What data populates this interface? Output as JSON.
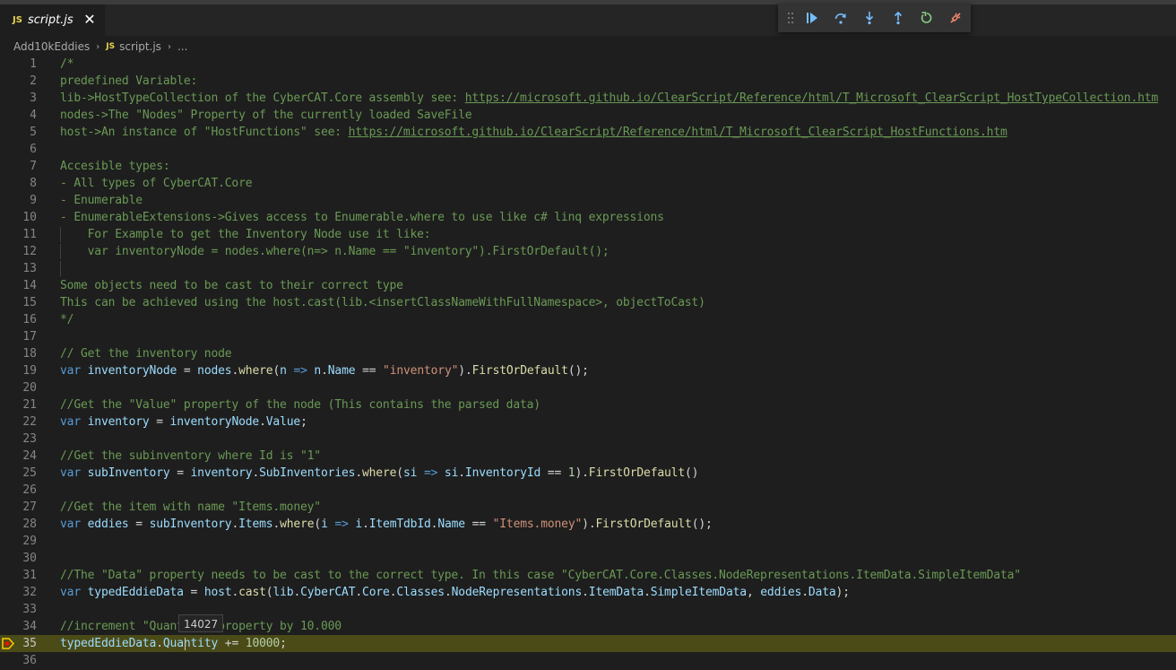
{
  "tab": {
    "badge": "JS",
    "label": "script.js",
    "close": "✕"
  },
  "breadcrumb": {
    "folder": "Add10kEddies",
    "badge": "JS",
    "file": "script.js",
    "more": "..."
  },
  "hover": {
    "value": "14027"
  },
  "lines": [
    {
      "n": "1",
      "t": [
        [
          "c",
          "/*"
        ]
      ]
    },
    {
      "n": "2",
      "t": [
        [
          "c",
          "predefined Variable:"
        ]
      ]
    },
    {
      "n": "3",
      "t": [
        [
          "c",
          "lib->HostTypeCollection of the CyberCAT.Core assembly see: "
        ],
        [
          "lnk",
          "https://microsoft.github.io/ClearScript/Reference/html/T_Microsoft_ClearScript_HostTypeCollection.htm"
        ]
      ]
    },
    {
      "n": "4",
      "t": [
        [
          "c",
          "nodes->The \"Nodes\" Property of the currently loaded SaveFile"
        ]
      ]
    },
    {
      "n": "5",
      "t": [
        [
          "c",
          "host->An instance of \"HostFunctions\" see: "
        ],
        [
          "lnk",
          "https://microsoft.github.io/ClearScript/Reference/html/T_Microsoft_ClearScript_HostFunctions.htm"
        ]
      ]
    },
    {
      "n": "6",
      "t": []
    },
    {
      "n": "7",
      "t": [
        [
          "c",
          "Accesible types:"
        ]
      ]
    },
    {
      "n": "8",
      "t": [
        [
          "c",
          "- All types of CyberCAT.Core"
        ]
      ]
    },
    {
      "n": "9",
      "t": [
        [
          "c",
          "- Enumerable"
        ]
      ]
    },
    {
      "n": "10",
      "t": [
        [
          "c",
          "- EnumerableExtensions->Gives access to Enumerable.where to use like c# linq expressions"
        ]
      ]
    },
    {
      "n": "11",
      "g": true,
      "t": [
        [
          "c",
          "    For Example to get the Inventory Node use it like:"
        ]
      ]
    },
    {
      "n": "12",
      "g": true,
      "t": [
        [
          "c",
          "    var inventoryNode = nodes.where(n=> n.Name == \"inventory\").FirstOrDefault();"
        ]
      ]
    },
    {
      "n": "13",
      "g": true,
      "t": []
    },
    {
      "n": "14",
      "t": [
        [
          "c",
          "Some objects need to be cast to their correct type"
        ]
      ]
    },
    {
      "n": "15",
      "t": [
        [
          "c",
          "This can be achieved using the host.cast(lib.<insertClassNameWithFullNamespace>, objectToCast)"
        ]
      ]
    },
    {
      "n": "16",
      "t": [
        [
          "c",
          "*/"
        ]
      ]
    },
    {
      "n": "17",
      "t": []
    },
    {
      "n": "18",
      "t": [
        [
          "c",
          "// Get the inventory node"
        ]
      ]
    },
    {
      "n": "19",
      "t": [
        [
          "k",
          "var "
        ],
        [
          "v",
          "inventoryNode"
        ],
        [
          "p",
          " = "
        ],
        [
          "v",
          "nodes"
        ],
        [
          "p",
          "."
        ],
        [
          "f",
          "where"
        ],
        [
          "p",
          "("
        ],
        [
          "v",
          "n"
        ],
        [
          "k",
          " => "
        ],
        [
          "v",
          "n"
        ],
        [
          "p",
          "."
        ],
        [
          "v",
          "Name"
        ],
        [
          "p",
          " == "
        ],
        [
          "s",
          "\"inventory\""
        ],
        [
          "p",
          ")."
        ],
        [
          "f",
          "FirstOrDefault"
        ],
        [
          "p",
          "();"
        ]
      ]
    },
    {
      "n": "20",
      "t": []
    },
    {
      "n": "21",
      "t": [
        [
          "c",
          "//Get the \"Value\" property of the node (This contains the parsed data)"
        ]
      ]
    },
    {
      "n": "22",
      "t": [
        [
          "k",
          "var "
        ],
        [
          "v",
          "inventory"
        ],
        [
          "p",
          " = "
        ],
        [
          "v",
          "inventoryNode"
        ],
        [
          "p",
          "."
        ],
        [
          "v",
          "Value"
        ],
        [
          "p",
          ";"
        ]
      ]
    },
    {
      "n": "23",
      "t": []
    },
    {
      "n": "24",
      "t": [
        [
          "c",
          "//Get the subinventory where Id is \"1\""
        ]
      ]
    },
    {
      "n": "25",
      "t": [
        [
          "k",
          "var "
        ],
        [
          "v",
          "subInventory"
        ],
        [
          "p",
          " = "
        ],
        [
          "v",
          "inventory"
        ],
        [
          "p",
          "."
        ],
        [
          "v",
          "SubInventories"
        ],
        [
          "p",
          "."
        ],
        [
          "f",
          "where"
        ],
        [
          "p",
          "("
        ],
        [
          "v",
          "si"
        ],
        [
          "k",
          " => "
        ],
        [
          "v",
          "si"
        ],
        [
          "p",
          "."
        ],
        [
          "v",
          "InventoryId"
        ],
        [
          "p",
          " == "
        ],
        [
          "n",
          "1"
        ],
        [
          "p",
          ")."
        ],
        [
          "f",
          "FirstOrDefault"
        ],
        [
          "p",
          "()"
        ]
      ]
    },
    {
      "n": "26",
      "t": []
    },
    {
      "n": "27",
      "t": [
        [
          "c",
          "//Get the item with name \"Items.money\""
        ]
      ]
    },
    {
      "n": "28",
      "t": [
        [
          "k",
          "var "
        ],
        [
          "v",
          "eddies"
        ],
        [
          "p",
          " = "
        ],
        [
          "v",
          "subInventory"
        ],
        [
          "p",
          "."
        ],
        [
          "v",
          "Items"
        ],
        [
          "p",
          "."
        ],
        [
          "f",
          "where"
        ],
        [
          "p",
          "("
        ],
        [
          "v",
          "i"
        ],
        [
          "k",
          " => "
        ],
        [
          "v",
          "i"
        ],
        [
          "p",
          "."
        ],
        [
          "v",
          "ItemTdbId"
        ],
        [
          "p",
          "."
        ],
        [
          "v",
          "Name"
        ],
        [
          "p",
          " == "
        ],
        [
          "s",
          "\"Items.money\""
        ],
        [
          "p",
          ")."
        ],
        [
          "f",
          "FirstOrDefault"
        ],
        [
          "p",
          "();"
        ]
      ]
    },
    {
      "n": "29",
      "t": []
    },
    {
      "n": "30",
      "t": []
    },
    {
      "n": "31",
      "t": [
        [
          "c",
          "//The \"Data\" property needs to be cast to the correct type. In this case \"CyberCAT.Core.Classes.NodeRepresentations.ItemData.SimpleItemData\""
        ]
      ]
    },
    {
      "n": "32",
      "t": [
        [
          "k",
          "var "
        ],
        [
          "v",
          "typedEddieData"
        ],
        [
          "p",
          " = "
        ],
        [
          "v",
          "host"
        ],
        [
          "p",
          "."
        ],
        [
          "f",
          "cast"
        ],
        [
          "p",
          "("
        ],
        [
          "v",
          "lib"
        ],
        [
          "p",
          "."
        ],
        [
          "v",
          "CyberCAT"
        ],
        [
          "p",
          "."
        ],
        [
          "v",
          "Core"
        ],
        [
          "p",
          "."
        ],
        [
          "v",
          "Classes"
        ],
        [
          "p",
          "."
        ],
        [
          "v",
          "NodeRepresentations"
        ],
        [
          "p",
          "."
        ],
        [
          "v",
          "ItemData"
        ],
        [
          "p",
          "."
        ],
        [
          "v",
          "SimpleItemData"
        ],
        [
          "p",
          ", "
        ],
        [
          "v",
          "eddies"
        ],
        [
          "p",
          "."
        ],
        [
          "v",
          "Data"
        ],
        [
          "p",
          ");"
        ]
      ]
    },
    {
      "n": "33",
      "t": []
    },
    {
      "n": "34",
      "t": [
        [
          "c",
          "//increment \"Quantity\" property by 10.000"
        ]
      ]
    },
    {
      "n": "35",
      "cur": true,
      "t": [
        [
          "v",
          "typedEddieData"
        ],
        [
          "p",
          "."
        ],
        [
          "v",
          "Quantity"
        ],
        [
          "p",
          " += "
        ],
        [
          "n",
          "10000"
        ],
        [
          "p",
          ";"
        ]
      ]
    },
    {
      "n": "36",
      "t": []
    }
  ]
}
